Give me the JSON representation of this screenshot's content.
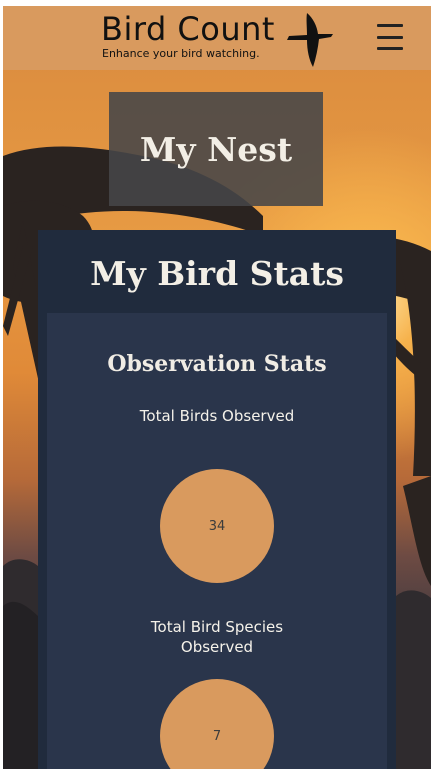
{
  "header": {
    "app_title": "Bird Count",
    "tagline": "Enhance your bird watching.",
    "logo_icon": "bird-silhouette-icon",
    "menu_icon": "hamburger-menu-icon",
    "background_color": "#d99a5e"
  },
  "nest": {
    "title": "My Nest"
  },
  "stats": {
    "title": "My Bird Stats",
    "section_title": "Observation Stats",
    "items": [
      {
        "label": "Total Birds Observed",
        "value": "34"
      },
      {
        "label": "Total Bird Species Observed",
        "value": "7"
      }
    ]
  },
  "colors": {
    "accent": "#d99a5e",
    "card_dark": "#202b3d",
    "card_inner": "#2a354b"
  }
}
